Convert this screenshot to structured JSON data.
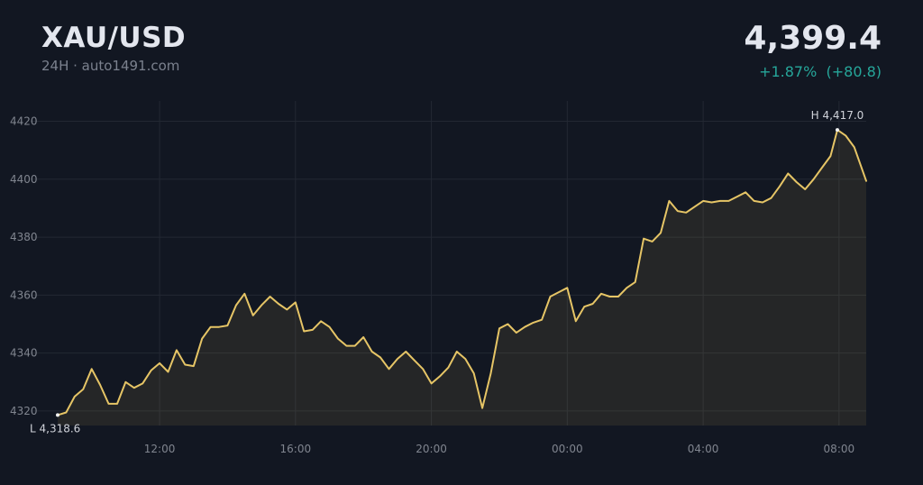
{
  "header": {
    "symbol": "XAU/USD",
    "subtitle": "24H · auto1491.com",
    "price": "4,399.4",
    "change_percent": "+1.87%",
    "change_abs": "(+80.8)"
  },
  "colors": {
    "background": "#121722",
    "line": "#e6c566",
    "positive": "#26a69a",
    "grid": "#262b36"
  },
  "chart_data": {
    "type": "line",
    "ylim": [
      4315,
      4427
    ],
    "yticks": [
      4320,
      4340,
      4360,
      4380,
      4400,
      4420
    ],
    "xticks": [
      "12:00",
      "16:00",
      "20:00",
      "00:00",
      "04:00",
      "08:00"
    ],
    "xtick_positions": [
      3.0,
      7.0,
      11.0,
      15.0,
      19.0,
      23.0
    ],
    "x_range": [
      0.0,
      23.8
    ],
    "grid": true,
    "annotations": [
      {
        "text": "H 4,417.0",
        "x": 22.95,
        "y": 4417.0
      },
      {
        "text": "L 4,318.6",
        "x": 0.0,
        "y": 4318.6
      }
    ],
    "series": [
      {
        "x": [
          0.0,
          0.25,
          0.5,
          0.75,
          1.0,
          1.25,
          1.5,
          1.75,
          2.0,
          2.25,
          2.5,
          2.75,
          3.0,
          3.25,
          3.5,
          3.75,
          4.0,
          4.25,
          4.5,
          4.75,
          5.0,
          5.25,
          5.5,
          5.75,
          6.0,
          6.25,
          6.5,
          6.75,
          7.0,
          7.25,
          7.5,
          7.75,
          8.0,
          8.25,
          8.5,
          8.75,
          9.0,
          9.25,
          9.5,
          9.75,
          10.0,
          10.25,
          10.5,
          10.75,
          11.0,
          11.25,
          11.5,
          11.75,
          12.0,
          12.25,
          12.5,
          12.75,
          13.0,
          13.25,
          13.5,
          13.75,
          14.0,
          14.25,
          14.5,
          14.75,
          15.0,
          15.25,
          15.5,
          15.75,
          16.0,
          16.25,
          16.5,
          16.75,
          17.0,
          17.25,
          17.5,
          17.75,
          18.0,
          18.25,
          18.5,
          18.75,
          19.0,
          19.25,
          19.5,
          19.75,
          20.0,
          20.25,
          20.5,
          20.75,
          21.0,
          21.25,
          21.5,
          21.75,
          22.0,
          22.25,
          22.5,
          22.75,
          22.95,
          23.2,
          23.45,
          23.8
        ],
        "values": [
          4318.6,
          4319.5,
          4325,
          4327.5,
          4334.5,
          4329,
          4322.5,
          4322.5,
          4330,
          4328,
          4329.5,
          4334,
          4336.5,
          4333.5,
          4341,
          4336,
          4335.5,
          4345,
          4349,
          4349,
          4349.5,
          4356.5,
          4360.5,
          4353,
          4356.5,
          4359.5,
          4357,
          4355,
          4357.5,
          4347.5,
          4348,
          4351,
          4349,
          4345,
          4342.5,
          4342.5,
          4345.5,
          4340.5,
          4338.5,
          4334.5,
          4338,
          4340.5,
          4337.5,
          4334.5,
          4329.5,
          4332,
          4335,
          4340.5,
          4338,
          4333,
          4321,
          4333,
          4348.5,
          4350,
          4347,
          4349,
          4350.5,
          4351.5,
          4359.5,
          4361,
          4362.5,
          4351,
          4356,
          4357,
          4360.5,
          4359.5,
          4359.5,
          4362.5,
          4364.5,
          4379.5,
          4378.5,
          4381.5,
          4392.5,
          4389,
          4388.5,
          4390.5,
          4392.5,
          4392,
          4392.5,
          4392.5,
          4394,
          4395.5,
          4392.5,
          4392,
          4393.5,
          4397.5,
          4402,
          4399,
          4396.5,
          4400,
          4404,
          4408,
          4417,
          4415,
          4411,
          4399.4
        ]
      }
    ]
  }
}
